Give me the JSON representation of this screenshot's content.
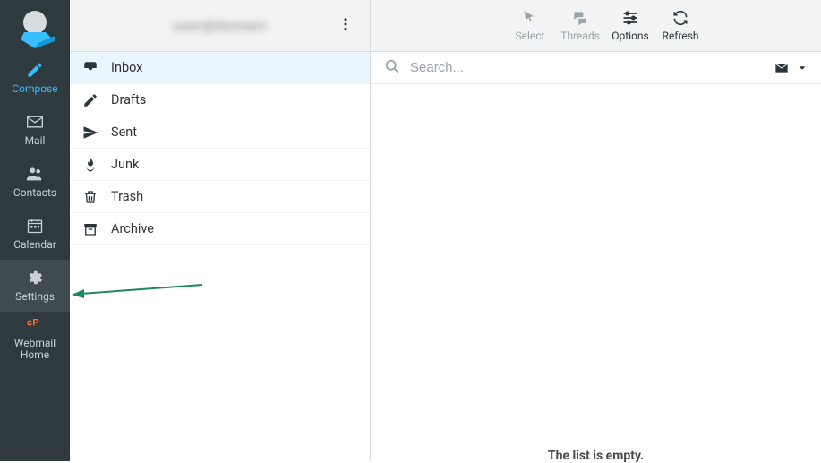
{
  "nav": {
    "compose": "Compose",
    "mail": "Mail",
    "contacts": "Contacts",
    "calendar": "Calendar",
    "settings": "Settings",
    "webmail_home": "Webmail\nHome"
  },
  "account": {
    "label": "user@domain"
  },
  "folders": {
    "inbox": "Inbox",
    "drafts": "Drafts",
    "sent": "Sent",
    "junk": "Junk",
    "trash": "Trash",
    "archive": "Archive"
  },
  "toolbar": {
    "select": "Select",
    "threads": "Threads",
    "options": "Options",
    "refresh": "Refresh"
  },
  "search": {
    "placeholder": "Search..."
  },
  "messages": {
    "empty": "The list is empty."
  }
}
